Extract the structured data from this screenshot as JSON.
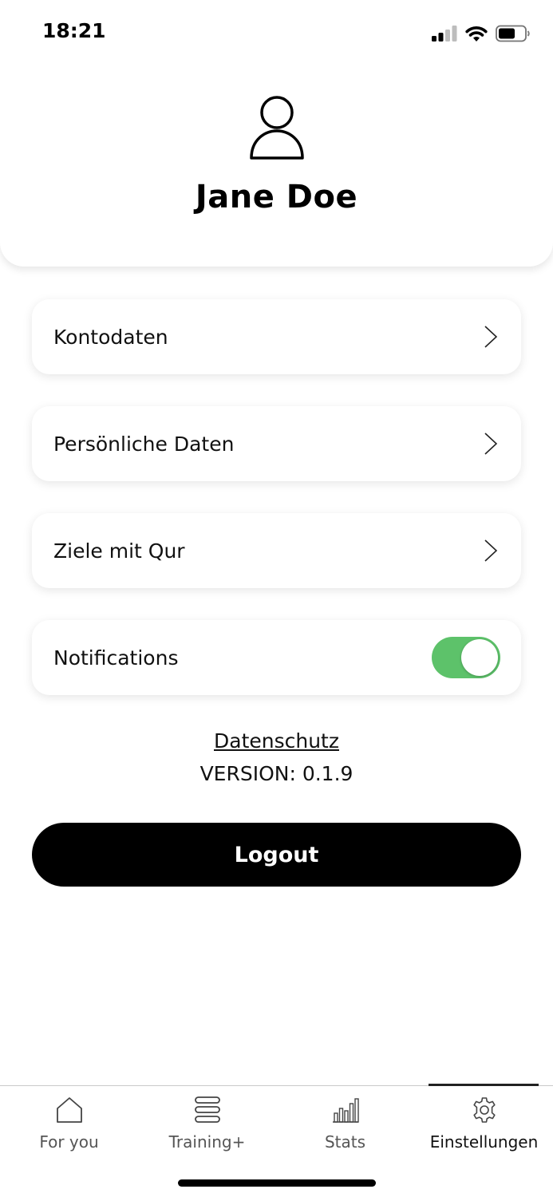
{
  "status_bar": {
    "time": "18:21"
  },
  "profile": {
    "name": "Jane Doe",
    "avatar_icon": "user-icon"
  },
  "menu": {
    "items": [
      {
        "label": "Kontodaten",
        "icon": "chevron-right-icon"
      },
      {
        "label": "Persönliche Daten",
        "icon": "chevron-right-icon"
      },
      {
        "label": "Ziele mit Qur",
        "icon": "chevron-right-icon"
      }
    ],
    "notifications": {
      "label": "Notifications",
      "enabled": true,
      "toggle_color": "#5dc26a"
    }
  },
  "footer": {
    "privacy_link": "Datenschutz",
    "version": "VERSION: 0.1.9",
    "logout_label": "Logout"
  },
  "bottom_nav": {
    "items": [
      {
        "label": "For you",
        "icon": "home-icon"
      },
      {
        "label": "Training+",
        "icon": "stack-icon"
      },
      {
        "label": "Stats",
        "icon": "bar-chart-icon"
      },
      {
        "label": "Einstellungen",
        "icon": "gear-icon",
        "active": true
      }
    ]
  }
}
